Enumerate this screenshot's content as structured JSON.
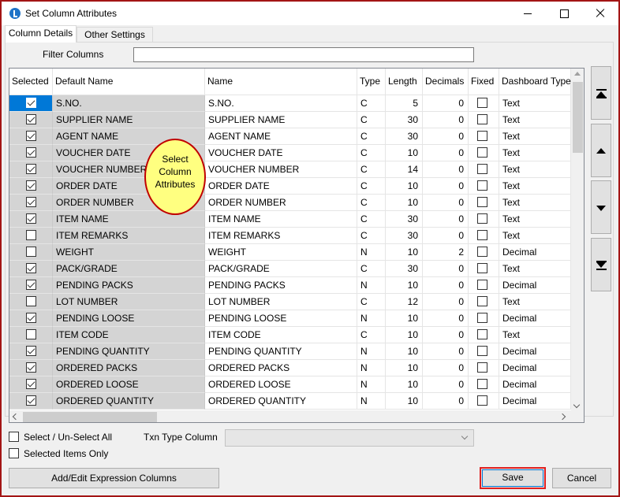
{
  "window": {
    "title": "Set Column Attributes"
  },
  "tabs": [
    {
      "label": "Column Details"
    },
    {
      "label": "Other Settings"
    }
  ],
  "filter": {
    "label": "Filter Columns",
    "value": ""
  },
  "grid": {
    "headers": [
      "Selected",
      "Default Name",
      "Name",
      "Type",
      "Length",
      "Decimals",
      "Fixed",
      "Dashboard Type"
    ],
    "rows": [
      {
        "selected": true,
        "default_name": "S.NO.",
        "name": "S.NO.",
        "type": "C",
        "length": "5",
        "decimals": "0",
        "fixed": false,
        "dashboard_type": "Text"
      },
      {
        "selected": true,
        "default_name": "SUPPLIER NAME",
        "name": "SUPPLIER NAME",
        "type": "C",
        "length": "30",
        "decimals": "0",
        "fixed": false,
        "dashboard_type": "Text"
      },
      {
        "selected": true,
        "default_name": "AGENT NAME",
        "name": "AGENT NAME",
        "type": "C",
        "length": "30",
        "decimals": "0",
        "fixed": false,
        "dashboard_type": "Text"
      },
      {
        "selected": true,
        "default_name": "VOUCHER DATE",
        "name": "VOUCHER DATE",
        "type": "C",
        "length": "10",
        "decimals": "0",
        "fixed": false,
        "dashboard_type": "Text"
      },
      {
        "selected": true,
        "default_name": "VOUCHER NUMBER",
        "name": "VOUCHER NUMBER",
        "type": "C",
        "length": "14",
        "decimals": "0",
        "fixed": false,
        "dashboard_type": "Text"
      },
      {
        "selected": true,
        "default_name": "ORDER DATE",
        "name": "ORDER DATE",
        "type": "C",
        "length": "10",
        "decimals": "0",
        "fixed": false,
        "dashboard_type": "Text"
      },
      {
        "selected": true,
        "default_name": "ORDER NUMBER",
        "name": "ORDER NUMBER",
        "type": "C",
        "length": "10",
        "decimals": "0",
        "fixed": false,
        "dashboard_type": "Text"
      },
      {
        "selected": true,
        "default_name": "ITEM NAME",
        "name": "ITEM NAME",
        "type": "C",
        "length": "30",
        "decimals": "0",
        "fixed": false,
        "dashboard_type": "Text"
      },
      {
        "selected": false,
        "default_name": "ITEM REMARKS",
        "name": "ITEM REMARKS",
        "type": "C",
        "length": "30",
        "decimals": "0",
        "fixed": false,
        "dashboard_type": "Text"
      },
      {
        "selected": false,
        "default_name": "WEIGHT",
        "name": "WEIGHT",
        "type": "N",
        "length": "10",
        "decimals": "2",
        "fixed": false,
        "dashboard_type": "Decimal"
      },
      {
        "selected": true,
        "default_name": "PACK/GRADE",
        "name": "PACK/GRADE",
        "type": "C",
        "length": "30",
        "decimals": "0",
        "fixed": false,
        "dashboard_type": "Text"
      },
      {
        "selected": true,
        "default_name": "PENDING PACKS",
        "name": "PENDING PACKS",
        "type": "N",
        "length": "10",
        "decimals": "0",
        "fixed": false,
        "dashboard_type": "Decimal"
      },
      {
        "selected": false,
        "default_name": "LOT NUMBER",
        "name": "LOT NUMBER",
        "type": "C",
        "length": "12",
        "decimals": "0",
        "fixed": false,
        "dashboard_type": "Text"
      },
      {
        "selected": true,
        "default_name": "PENDING LOOSE",
        "name": "PENDING LOOSE",
        "type": "N",
        "length": "10",
        "decimals": "0",
        "fixed": false,
        "dashboard_type": "Decimal"
      },
      {
        "selected": false,
        "default_name": "ITEM CODE",
        "name": "ITEM CODE",
        "type": "C",
        "length": "10",
        "decimals": "0",
        "fixed": false,
        "dashboard_type": "Text"
      },
      {
        "selected": true,
        "default_name": "PENDING QUANTITY",
        "name": "PENDING QUANTITY",
        "type": "N",
        "length": "10",
        "decimals": "0",
        "fixed": false,
        "dashboard_type": "Decimal"
      },
      {
        "selected": true,
        "default_name": "ORDERED PACKS",
        "name": "ORDERED PACKS",
        "type": "N",
        "length": "10",
        "decimals": "0",
        "fixed": false,
        "dashboard_type": "Decimal"
      },
      {
        "selected": true,
        "default_name": "ORDERED LOOSE",
        "name": "ORDERED LOOSE",
        "type": "N",
        "length": "10",
        "decimals": "0",
        "fixed": false,
        "dashboard_type": "Decimal"
      },
      {
        "selected": true,
        "default_name": "ORDERED QUANTITY",
        "name": "ORDERED QUANTITY",
        "type": "N",
        "length": "10",
        "decimals": "0",
        "fixed": false,
        "dashboard_type": "Decimal"
      }
    ]
  },
  "callout": {
    "line1": "Select",
    "line2": "Column",
    "line3": "Attributes"
  },
  "side_buttons": [
    "move-top-icon",
    "move-up-icon",
    "move-down-icon",
    "move-bottom-icon"
  ],
  "options": {
    "select_all_label": "Select / Un-Select All",
    "selected_only_label": "Selected Items Only",
    "select_all_checked": false,
    "selected_only_checked": false,
    "txn_type_label": "Txn Type Column",
    "txn_type_value": ""
  },
  "buttons": {
    "expression": "Add/Edit Expression Columns",
    "save": "Save",
    "cancel": "Cancel"
  },
  "colors": {
    "selection_blue": "#0078d7",
    "callout_fill": "#ffff80",
    "callout_border": "#c00000",
    "highlight_red": "#e02020"
  }
}
